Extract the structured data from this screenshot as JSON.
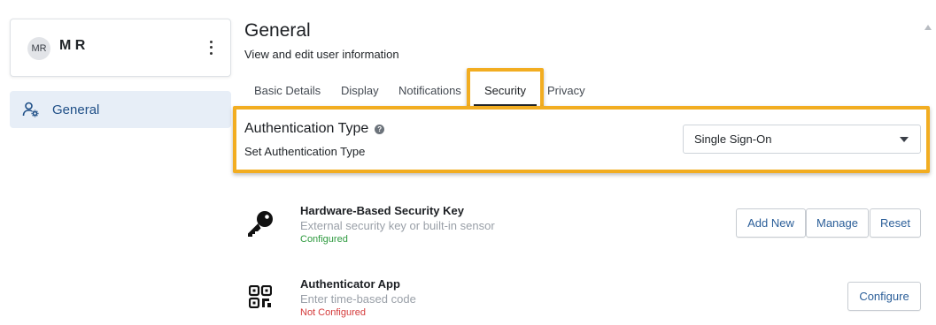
{
  "sidebar": {
    "profile": {
      "initials": "MR",
      "name": "M R"
    },
    "nav_items": [
      {
        "label": "General"
      }
    ]
  },
  "header": {
    "title": "General",
    "subtitle": "View and edit user information"
  },
  "tabs": [
    {
      "label": "Basic Details"
    },
    {
      "label": "Display"
    },
    {
      "label": "Notifications"
    },
    {
      "label": "Security",
      "active": true
    },
    {
      "label": "Privacy"
    }
  ],
  "auth": {
    "title": "Authentication Type",
    "help_glyph": "?",
    "subtitle": "Set Authentication Type",
    "selected": "Single Sign-On"
  },
  "methods": [
    {
      "title": "Hardware-Based Security Key",
      "description": "External security key or built-in sensor",
      "status": "Configured",
      "icon": "key-icon",
      "actions": [
        "Add New",
        "Manage",
        "Reset"
      ]
    },
    {
      "title": "Authenticator App",
      "description": "Enter time-based code",
      "status": "Not Configured",
      "icon": "qr-code-icon",
      "actions": [
        "Configure"
      ]
    }
  ],
  "colors": {
    "highlight": "#f2ad21",
    "nav_active_bg": "#e7eef7",
    "link": "#2c5f99",
    "status_ok": "#2e9a3f",
    "status_bad": "#d43a3a"
  }
}
